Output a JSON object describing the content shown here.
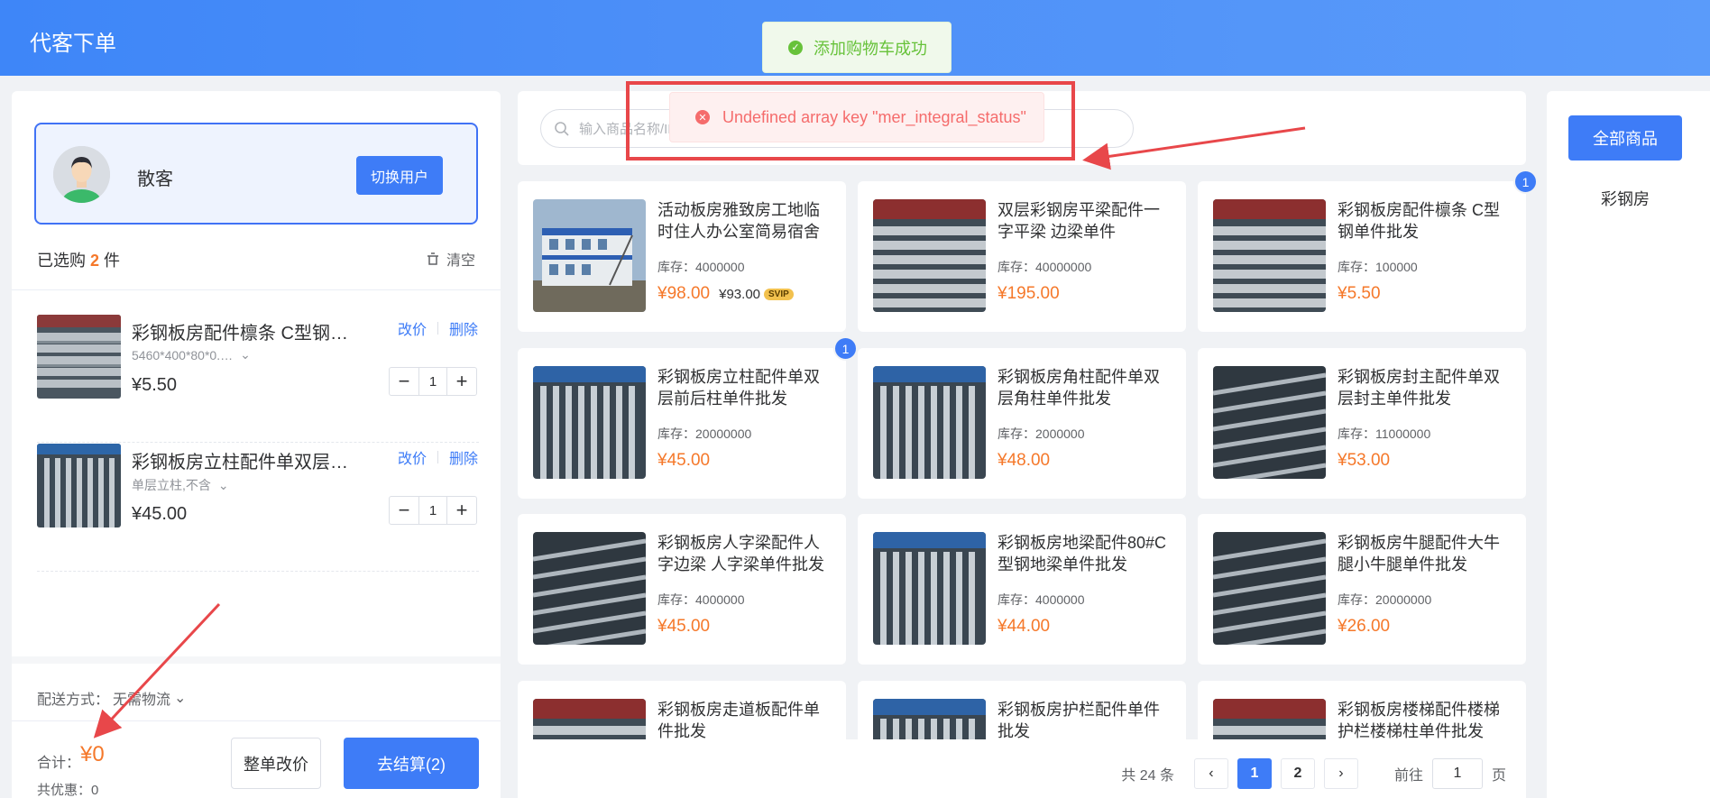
{
  "header": {
    "title": "代客下单"
  },
  "toasts": {
    "success": "添加购物车成功",
    "error": "Undefined array key \"mer_integral_status\""
  },
  "user": {
    "name": "散客",
    "switch_label": "切换用户"
  },
  "cart": {
    "selected_prefix": "已选购",
    "selected_count": "2",
    "selected_suffix": "件",
    "clear_label": "清空",
    "items": [
      {
        "name": "彩钢板房配件檩条 C型钢单件批发",
        "spec": "5460*400*80*0.…",
        "price": "¥5.50",
        "qty": "1",
        "edit_label": "改价",
        "delete_label": "删除"
      },
      {
        "name": "彩钢板房立柱配件单双层前后柱单件批发",
        "spec": "单层立柱,不含",
        "price": "¥45.00",
        "qty": "1",
        "edit_label": "改价",
        "delete_label": "删除"
      }
    ]
  },
  "summary": {
    "delivery_label": "配送方式：",
    "delivery_value": "无需物流",
    "total_label": "合计：",
    "total_value": "¥0",
    "discount_label": "共优惠：",
    "discount_value": "0",
    "modify_all_label": "整单改价",
    "checkout_label": "去结算(2)"
  },
  "search": {
    "placeholder": "输入商品名称/ID"
  },
  "products": [
    {
      "name": "活动板房雅致房工地临时住人办公室简易宿舍",
      "stock": "库存：4000000",
      "price": "¥98.00",
      "svip_price": "¥93.00",
      "svip": "SVIP",
      "badge": "",
      "image": "building"
    },
    {
      "name": "双层彩钢房平梁配件一字平梁 边梁单件",
      "stock": "库存：40000000",
      "price": "¥195.00",
      "badge": "",
      "image": "steel-red"
    },
    {
      "name": "彩钢板房配件檩条 C型钢单件批发",
      "stock": "库存：100000",
      "price": "¥5.50",
      "badge": "1",
      "image": "steel-red"
    },
    {
      "name": "彩钢板房立柱配件单双层前后柱单件批发",
      "stock": "库存：20000000",
      "price": "¥45.00",
      "badge": "1",
      "image": "steel-blue"
    },
    {
      "name": "彩钢板房角柱配件单双层角柱单件批发",
      "stock": "库存：2000000",
      "price": "¥48.00",
      "badge": "",
      "image": "steel-blue"
    },
    {
      "name": "彩钢板房封主配件单双层封主单件批发",
      "stock": "库存：11000000",
      "price": "¥53.00",
      "badge": "",
      "image": "steel-dark"
    },
    {
      "name": "彩钢板房人字梁配件人字边梁 人字梁单件批发",
      "stock": "库存：4000000",
      "price": "¥45.00",
      "badge": "",
      "image": "steel-dark"
    },
    {
      "name": "彩钢板房地梁配件80#C型钢地梁单件批发",
      "stock": "库存：4000000",
      "price": "¥44.00",
      "badge": "",
      "image": "steel-blue"
    },
    {
      "name": "彩钢板房牛腿配件大牛腿小牛腿单件批发",
      "stock": "库存：20000000",
      "price": "¥26.00",
      "badge": "",
      "image": "steel-dark"
    },
    {
      "name": "彩钢板房走道板配件单件批发",
      "stock": "",
      "price": "",
      "badge": "",
      "image": "steel-red"
    },
    {
      "name": "彩钢板房护栏配件单件批发",
      "stock": "",
      "price": "",
      "badge": "",
      "image": "steel-blue"
    },
    {
      "name": "彩钢板房楼梯配件楼梯护栏楼梯柱单件批发",
      "stock": "",
      "price": "",
      "badge": "",
      "image": "steel-red"
    }
  ],
  "pagination": {
    "total": "共 24 条",
    "pages": [
      "1",
      "2"
    ],
    "current": "1",
    "goto_prefix": "前往",
    "goto_value": "1",
    "goto_suffix": "页"
  },
  "categories": {
    "all_label": "全部商品",
    "items": [
      "彩钢房"
    ]
  },
  "colors": {
    "primary": "#3e7cf7",
    "price": "#f5782a",
    "error": "#f56c6c",
    "success": "#67c23a",
    "annotation": "#e8474a"
  }
}
